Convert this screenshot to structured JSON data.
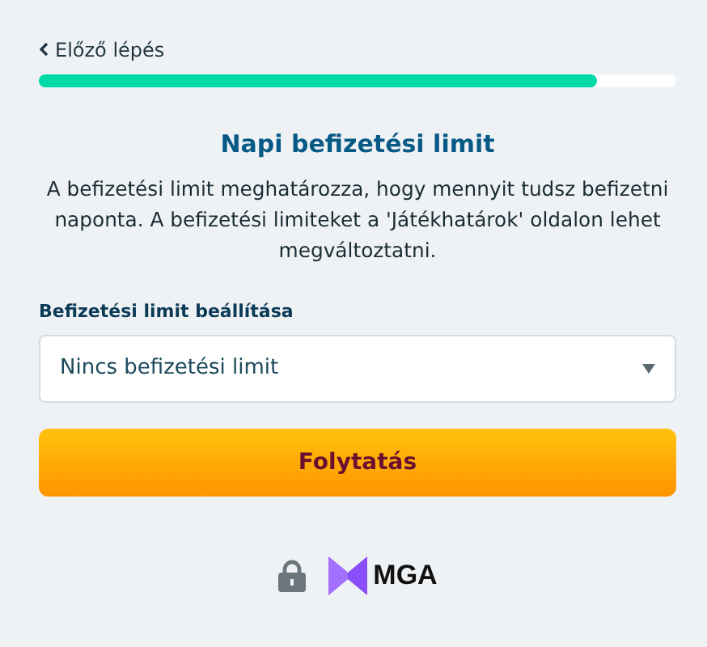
{
  "back_link": {
    "label": "Előző lépés"
  },
  "progress": {
    "level": 0.876
  },
  "title": "Napi befizetési limit",
  "description": "A befizetési limit meghatározza, hogy mennyit tudsz befizetni naponta. A befizetési limiteket a 'Játékhatárok' oldalon lehet megváltoztatni.",
  "limit_field": {
    "label": "Befizetési limit beállítása",
    "value": "Nincs befizetési limit"
  },
  "continue_button": {
    "label": "Folytatás"
  },
  "footer": {
    "badge_text": "MGA"
  }
}
